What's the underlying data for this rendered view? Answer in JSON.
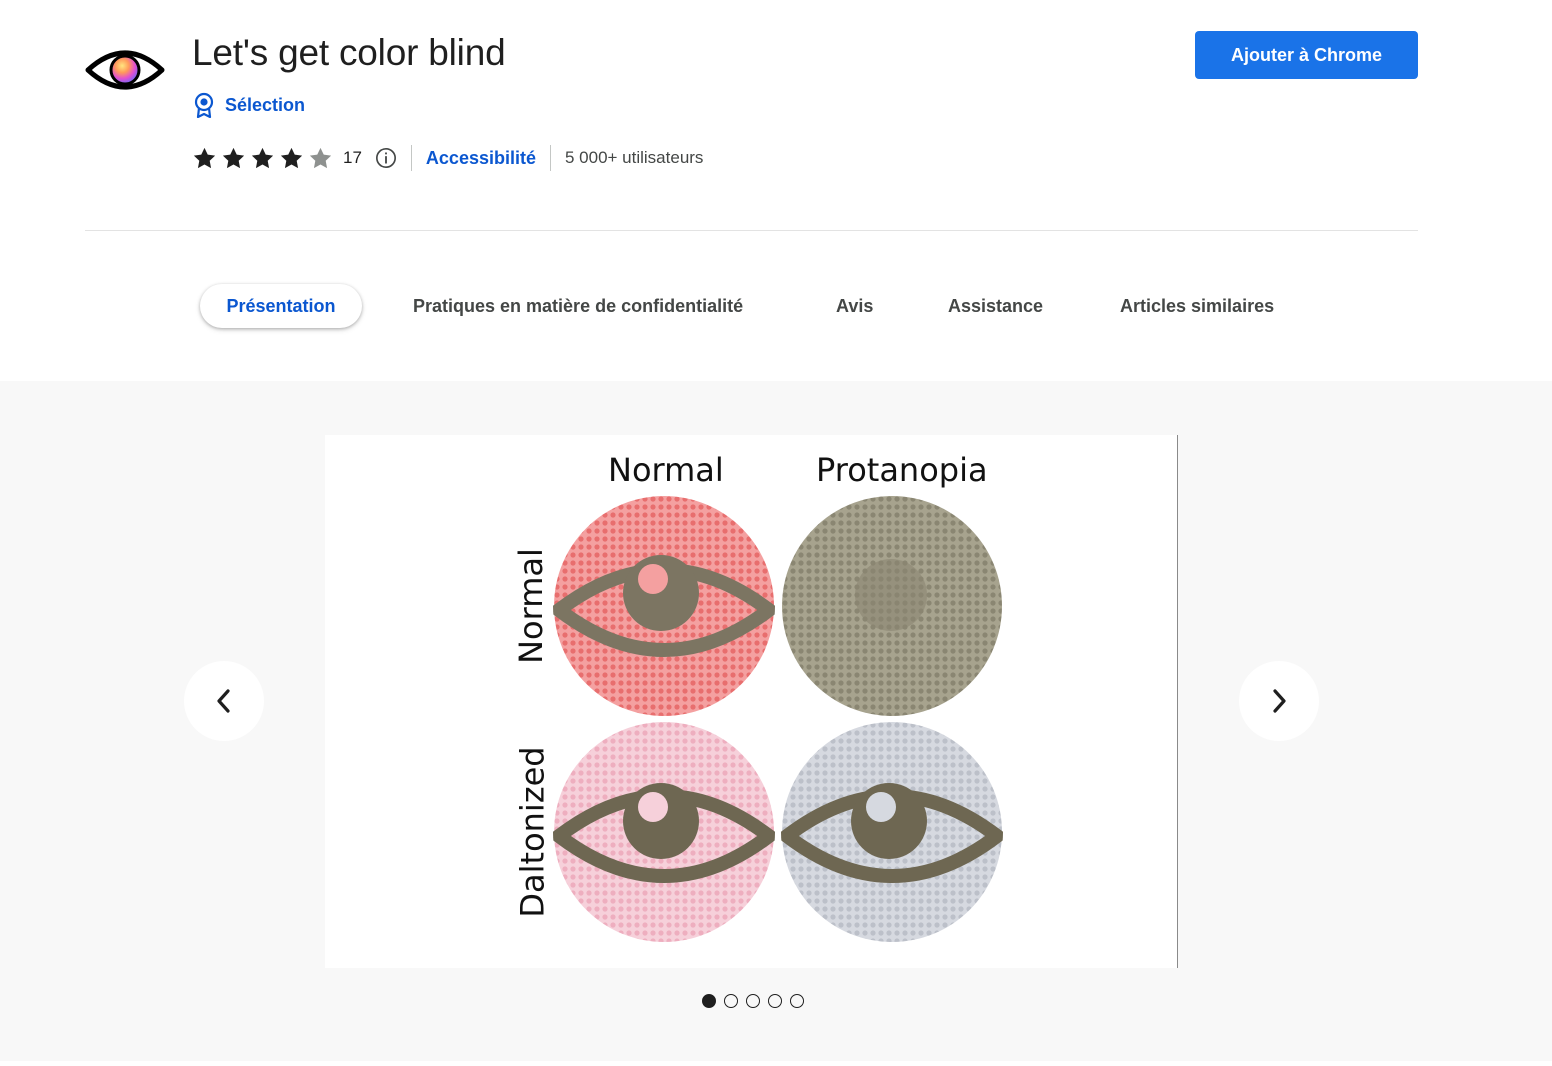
{
  "header": {
    "title": "Let's get color blind",
    "badge_label": "Sélection",
    "rating": {
      "value": 4,
      "max": 5,
      "count": "17"
    },
    "category": "Accessibilité",
    "users": "5 000+ utilisateurs",
    "add_button": "Ajouter à Chrome"
  },
  "tabs": [
    {
      "label": "Présentation",
      "active": true
    },
    {
      "label": "Pratiques en matière de confidentialité",
      "active": false
    },
    {
      "label": "Avis",
      "active": false
    },
    {
      "label": "Assistance",
      "active": false
    },
    {
      "label": "Articles similaires",
      "active": false
    }
  ],
  "gallery": {
    "slide": {
      "columns": [
        "Normal",
        "Protanopia"
      ],
      "rows": [
        "Normal",
        "Daltonized"
      ]
    },
    "dot_count": 5,
    "active_dot": 1
  },
  "colors": {
    "accent": "#0b57d0",
    "button": "#1a73e8",
    "plate_normal_normal": "#ef8a8a",
    "plate_normal_protanopia": "#9a9680",
    "plate_daltonized_normal": "#f0bfcc",
    "plate_daltonized_protanopia": "#c8ccd4"
  }
}
